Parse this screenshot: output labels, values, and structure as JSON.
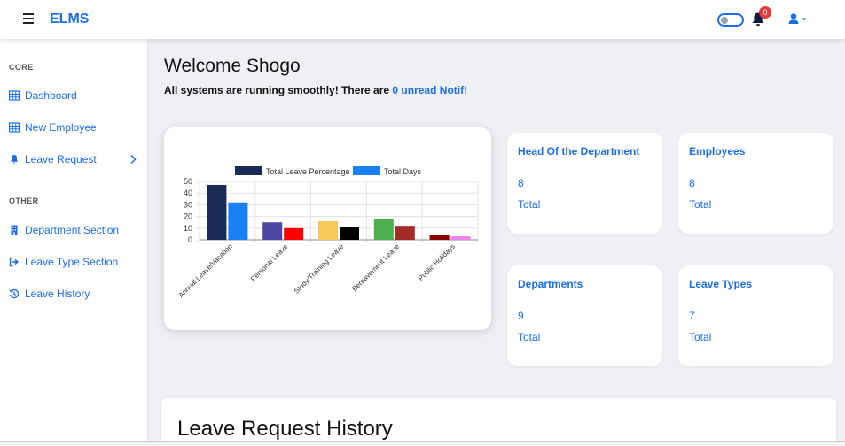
{
  "header": {
    "brand": "ELMS",
    "notification_count": "0",
    "icons": [
      "hamburger-icon",
      "theme-toggle",
      "bell-icon",
      "user-icon",
      "caret-down-icon"
    ]
  },
  "sidebar": {
    "core_label": "CORE",
    "other_label": "OTHER",
    "items": [
      {
        "label": "Dashboard",
        "icon": "table-icon"
      },
      {
        "label": "New Employee",
        "icon": "table-icon"
      },
      {
        "label": "Leave Request",
        "icon": "bell-icon"
      },
      {
        "label": "Department Section",
        "icon": "building-icon"
      },
      {
        "label": "Leave Type Section",
        "icon": "sign-out-icon"
      },
      {
        "label": "Leave History",
        "icon": "history-icon"
      }
    ]
  },
  "main": {
    "welcome": "Welcome Shogo",
    "status_prefix": "All systems are running smoothly! There are ",
    "status_link": "0 unread Notif!",
    "cards": [
      {
        "title": "Head Of the Department",
        "value": "8",
        "label": "Total"
      },
      {
        "title": "Employees",
        "value": "8",
        "label": "Total"
      },
      {
        "title": "Departments",
        "value": "9",
        "label": "Total"
      },
      {
        "title": "Leave Types",
        "value": "7",
        "label": "Total"
      }
    ],
    "history_title": "Leave Request History"
  },
  "colors": {
    "accent": "#1d6ee6",
    "badge": "#e23b3b"
  },
  "chart_data": {
    "type": "bar",
    "categories": [
      "Annual Leave/Vacation",
      "Personal Leave",
      "Study/Training Leave",
      "Bereavement Leave",
      "Public Holidays"
    ],
    "series": [
      {
        "name": "Total Leave Percentage",
        "values": [
          47,
          15,
          16,
          18,
          4
        ],
        "colors": [
          "#1a2b57",
          "#4b47a0",
          "#f7c95c",
          "#4caf50",
          "#8b0000"
        ]
      },
      {
        "name": "Total Days",
        "values": [
          32,
          10,
          11,
          12,
          3
        ],
        "colors": [
          "#1a7ff5",
          "#ff0000",
          "#000000",
          "#a52a2a",
          "#ee82ee"
        ]
      }
    ],
    "legend_colors": [
      "#1a2b57",
      "#1a7ff5"
    ],
    "yticks": [
      "0",
      "10",
      "20",
      "30",
      "40",
      "50"
    ],
    "ylim": [
      0,
      50
    ],
    "grid": true,
    "legend": "top"
  }
}
